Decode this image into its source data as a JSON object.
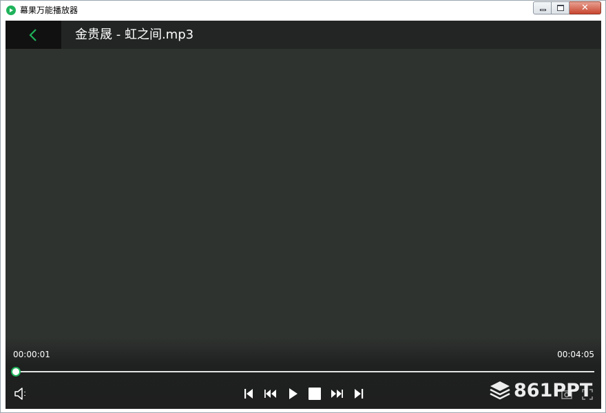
{
  "window": {
    "title": "幕果万能播放器",
    "close_glyph": "✕"
  },
  "player": {
    "media_title": "金贵晟 - 虹之间.mp3",
    "current_time": "00:00:01",
    "total_time": "00:04:05",
    "progress_fraction": 0.004,
    "accent_color": "#1fb35b"
  },
  "controls": {
    "icons": [
      "volume-icon",
      "skip-previous-icon",
      "rewind-icon",
      "play-icon",
      "stop-icon",
      "fast-forward-icon",
      "skip-next-icon",
      "screenshot-icon",
      "fullscreen-icon"
    ]
  },
  "watermark": {
    "text": "861PPT"
  }
}
